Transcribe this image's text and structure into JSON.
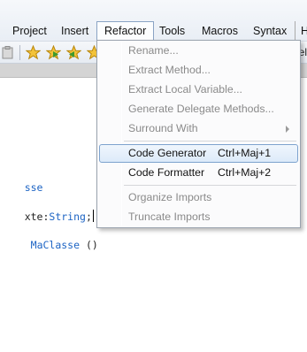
{
  "menubar": {
    "items": [
      "Project",
      "Insert",
      "Refactor",
      "Tools",
      "Macros",
      "Syntax",
      "H"
    ],
    "active": "Refactor"
  },
  "toolbar": {
    "cut_text": "el"
  },
  "editor": {
    "lines": [
      {
        "text": "sse"
      },
      {
        "prefix": "xte:",
        "type": "String",
        "suffix": ";"
      },
      {
        "indent": " ",
        "name": "MaClasse",
        "call": " ()"
      }
    ]
  },
  "refactor_menu": {
    "items": [
      {
        "label": "Rename...",
        "enabled": false
      },
      {
        "label": "Extract Method...",
        "enabled": false
      },
      {
        "label": "Extract Local Variable...",
        "enabled": false
      },
      {
        "label": "Generate Delegate Methods...",
        "enabled": false
      },
      {
        "label": "Surround With",
        "enabled": false,
        "submenu": true
      },
      {
        "label": "Code Generator",
        "shortcut": "Ctrl+Maj+1",
        "enabled": true,
        "highlighted": true
      },
      {
        "label": "Code Formatter",
        "shortcut": "Ctrl+Maj+2",
        "enabled": true
      },
      {
        "label": "Organize Imports",
        "enabled": false
      },
      {
        "label": "Truncate Imports",
        "enabled": false
      }
    ]
  },
  "colors": {
    "keyword": "#1d64c4",
    "highlight_border": "#7da2ce",
    "disabled_text": "#8a8a8a"
  }
}
